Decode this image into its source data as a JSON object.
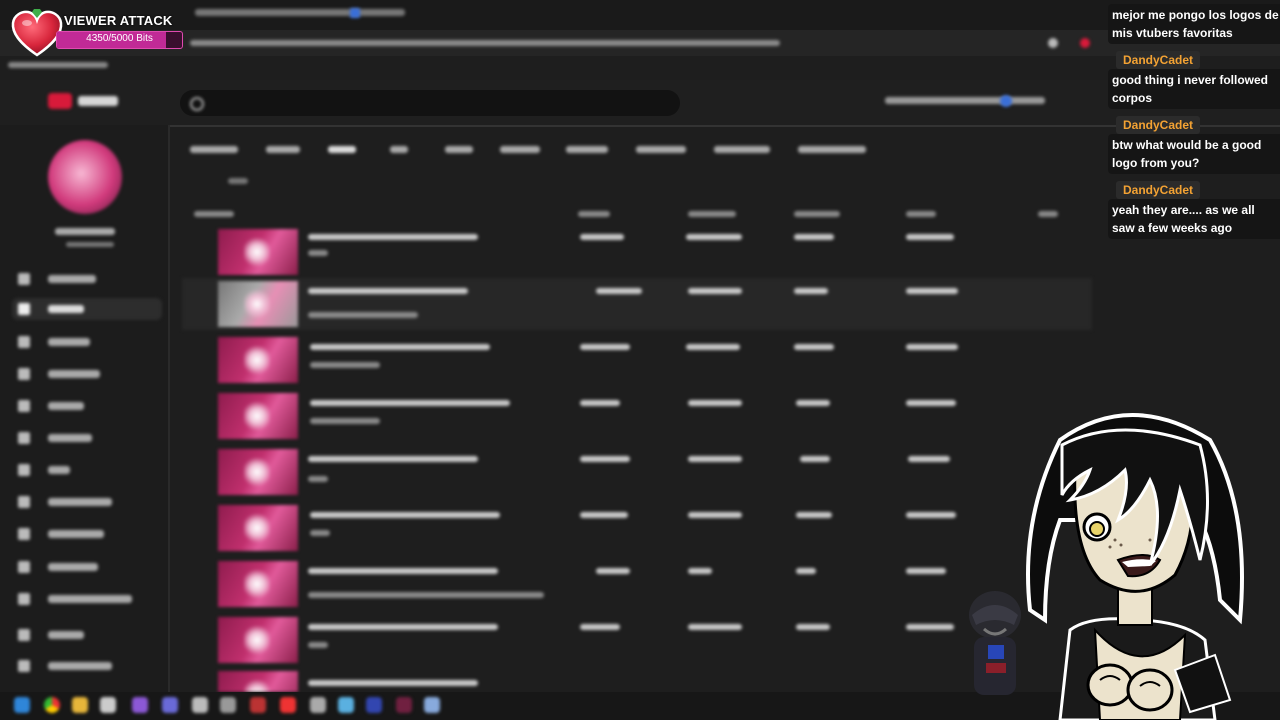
{
  "overlay": {
    "title": "VIEWER ATTACK",
    "bits_text": "4350/5000 Bits",
    "bits_progress": 0.87,
    "heart_color": "#d8263c",
    "bar_color": "#c12a96"
  },
  "chat": {
    "messages": [
      {
        "user": "",
        "text": "mejor me pongo los logos de mis vtubers favoritas"
      },
      {
        "user": "DandyCadet",
        "text": "good thing i never followed corpos"
      },
      {
        "user": "DandyCadet",
        "text": "btw what would be a good logo from you?"
      },
      {
        "user": "DandyCadet",
        "text": "yeah they are.... as we all saw a few weeks ago"
      }
    ],
    "username_color": "#f3a233"
  },
  "browser": {
    "accent": "#d81a3a",
    "theme": "dark",
    "content_state": "pixelated"
  }
}
